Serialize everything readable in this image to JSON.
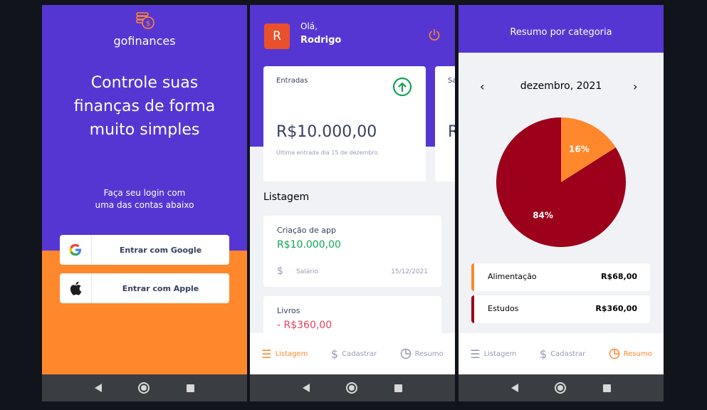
{
  "login": {
    "brand": "gofinances",
    "headline_lines": [
      "Controle suas",
      "finanças de forma",
      "muito simples"
    ],
    "subtitle_lines": [
      "Faça seu login com",
      "uma das contas abaixo"
    ],
    "google_label": "Entrar com Google",
    "apple_label": "Entrar com Apple",
    "colors": {
      "primary": "#5636d3",
      "secondary": "#ff872c"
    }
  },
  "dashboard": {
    "avatar_initial": "R",
    "greeting": "Olá,",
    "user_name": "Rodrigo",
    "highlight_cards": [
      {
        "title": "Entradas",
        "amount": "R$10.000,00",
        "last": "Última entrada dia 15 de dezembro",
        "icon": "arrow-up-circle-icon"
      },
      {
        "title": "Sa",
        "amount": "R"
      }
    ],
    "listing_title": "Listagem",
    "transactions": [
      {
        "title": "Criação de app",
        "amount": "R$10.000,00",
        "type": "income",
        "category": "Salário",
        "date": "15/12/2021"
      },
      {
        "title": "Livros",
        "amount": "- R$360,00",
        "type": "outcome"
      }
    ],
    "tabs": [
      {
        "label": "Listagem",
        "icon": "list-icon",
        "active": true
      },
      {
        "label": "Cadastrar",
        "icon": "dollar-icon",
        "active": false
      },
      {
        "label": "Resumo",
        "icon": "pie-chart-icon",
        "active": false
      }
    ]
  },
  "resume": {
    "title": "Resumo por categoria",
    "month": "dezembro, 2021",
    "categories": [
      {
        "name": "Alimentação",
        "amount": "R$68,00",
        "color": "#ff872c",
        "percent": 16
      },
      {
        "name": "Estudos",
        "amount": "R$360,00",
        "color": "#9c001a",
        "percent": 84
      }
    ],
    "tabs": [
      {
        "label": "Listagem",
        "icon": "list-icon",
        "active": false
      },
      {
        "label": "Cadastrar",
        "icon": "dollar-icon",
        "active": false
      },
      {
        "label": "Resumo",
        "icon": "pie-chart-icon",
        "active": true
      }
    ]
  },
  "chart_data": {
    "type": "pie",
    "categories": [
      "Alimentação",
      "Estudos"
    ],
    "values": [
      16,
      84
    ],
    "labels": [
      "16%",
      "84%"
    ]
  }
}
